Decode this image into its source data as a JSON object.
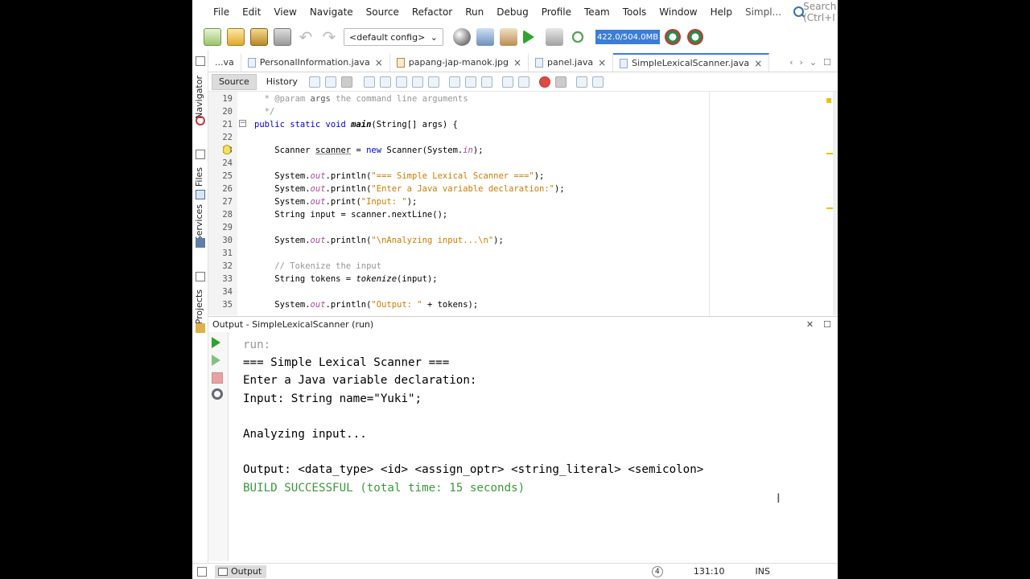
{
  "menu": [
    "File",
    "Edit",
    "View",
    "Navigate",
    "Source",
    "Refactor",
    "Run",
    "Debug",
    "Profile",
    "Team",
    "Tools",
    "Window",
    "Help"
  ],
  "window_title_short": "Simpl...",
  "search_placeholder": "Search (Ctrl+I",
  "config": "<default config>",
  "memory": "422.0/504.0MB",
  "side_tabs": [
    "Navigator",
    "Files",
    "Services",
    "Projects"
  ],
  "editor_tabs": [
    "...va",
    "PersonalInformation.java",
    "papang-jap-manok.jpg",
    "panel.java",
    "SimpleLexicalScanner.java"
  ],
  "source_label": "Source",
  "history_label": "History",
  "code": {
    "line_numbers": [
      "19",
      "20",
      "21",
      "22",
      "23",
      "24",
      "25",
      "26",
      "27",
      "28",
      "29",
      "30",
      "31",
      "32",
      "33",
      "34",
      "35"
    ]
  },
  "output": {
    "title": "Output - SimpleLexicalScanner (run)",
    "lines": [
      "run:",
      "=== Simple Lexical Scanner ===",
      "Enter a Java variable declaration:",
      "Input: String name=\"Yuki\";",
      "",
      "Analyzing input...",
      "",
      "Output: <data_type> <id> <assign_optr> <string_literal> <semicolon>",
      "BUILD SUCCESSFUL (total time: 15 seconds)"
    ]
  },
  "status": {
    "output_tab": "Output",
    "notifications": "4",
    "position": "131:10",
    "mode": "INS"
  }
}
